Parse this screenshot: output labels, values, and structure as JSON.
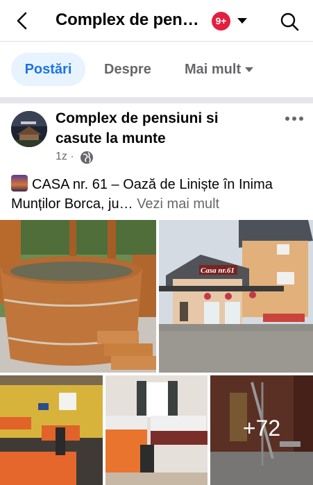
{
  "header": {
    "title": "Complex de pen…",
    "notification_count": "9+"
  },
  "tabs": [
    {
      "label": "Postări",
      "active": true
    },
    {
      "label": "Despre",
      "active": false
    },
    {
      "label": "Mai mult",
      "active": false
    }
  ],
  "post": {
    "author": "Complex de pensiuni si casute la munte",
    "time": "1z ·",
    "text": "CASA nr. 61 – Oază de Liniște în Inima Munților Borca, ju…",
    "see_more": "Vezi mai mult",
    "sign_text": "Casa nr.61",
    "more_photos": "+72"
  },
  "colors": {
    "accent": "#1b74e4",
    "badge": "#e41e3f",
    "tab_active_bg": "#e7f3ff"
  }
}
